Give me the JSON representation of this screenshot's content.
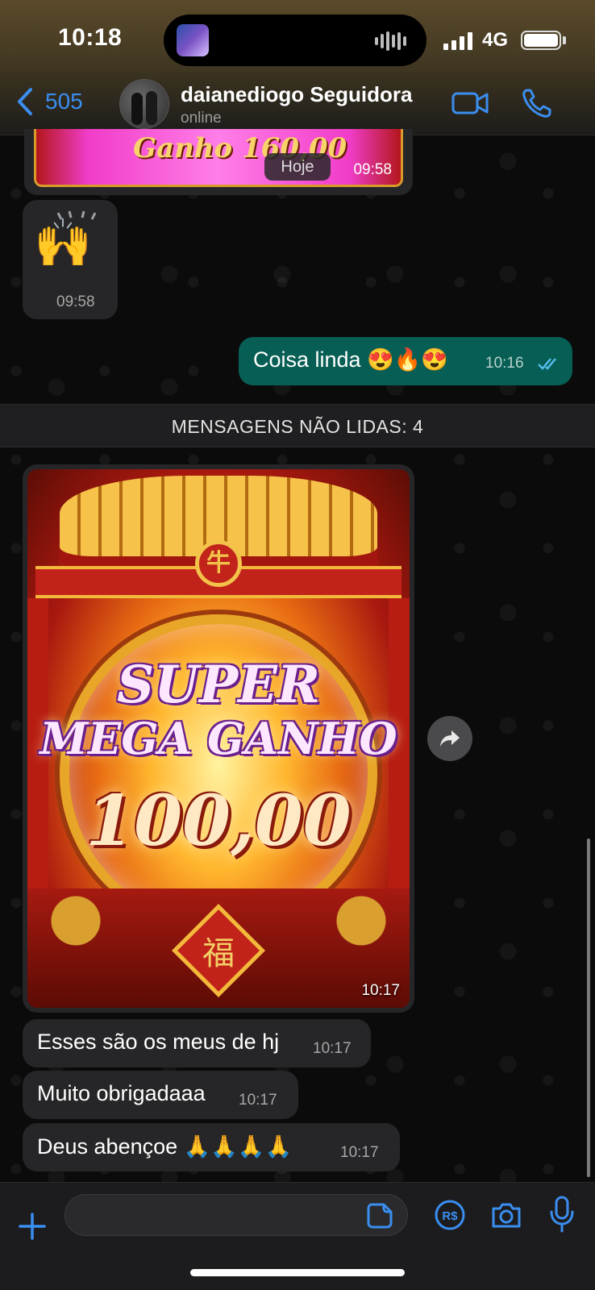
{
  "status_bar": {
    "time": "10:18",
    "network": "4G"
  },
  "header": {
    "back_count": "505",
    "contact_name": "daianediogo Seguidora",
    "contact_status": "online"
  },
  "messages": {
    "top_image": {
      "text": "Ganho 160,00",
      "time": "09:58"
    },
    "date_chip": "Hoje",
    "emoji_msg": {
      "emoji": "🙌",
      "time": "09:58"
    },
    "outgoing": {
      "text": "Coisa linda 😍🔥😍",
      "time": "10:16"
    },
    "unread_banner": "MENSAGENS NÃO LIDAS: 4",
    "image_msg": {
      "line1": "SUPER",
      "line2": "MEGA GANHO",
      "amount": "100,00",
      "sign": "福",
      "medal": "牛",
      "time": "10:17"
    },
    "msg1": {
      "text": "Esses são os meus de hj",
      "time": "10:17"
    },
    "msg2": {
      "text": "Muito obrigadaaa",
      "time": "10:17"
    },
    "msg3": {
      "text": "Deus abençoe 🙏🙏🙏🙏",
      "time": "10:17"
    }
  },
  "input": {
    "placeholder": ""
  },
  "colors": {
    "accent": "#3a8ef0",
    "outgoing_bubble": "#075e54",
    "incoming_bubble": "#262628",
    "read_ticks": "#53bdeb"
  },
  "icons": [
    "chevron-left-icon",
    "video-icon",
    "phone-icon",
    "forward-icon",
    "plus-icon",
    "sticker-icon",
    "pay-icon",
    "camera-icon",
    "mic-icon"
  ]
}
